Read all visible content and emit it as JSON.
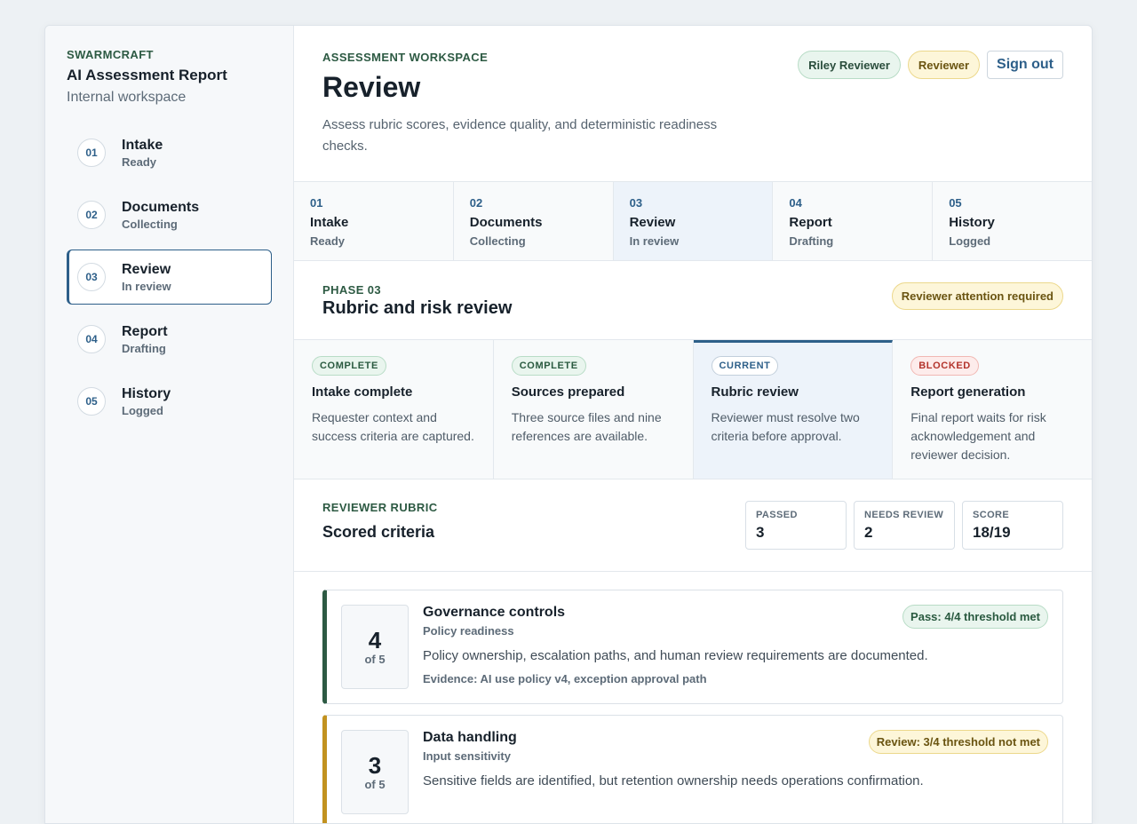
{
  "brand": "SWARMCRAFT",
  "app": {
    "title": "AI Assessment Report",
    "subtitle": "Internal workspace"
  },
  "nav": [
    {
      "num": "01",
      "label": "Intake",
      "status": "Ready"
    },
    {
      "num": "02",
      "label": "Documents",
      "status": "Collecting"
    },
    {
      "num": "03",
      "label": "Review",
      "status": "In review",
      "active": true
    },
    {
      "num": "04",
      "label": "Report",
      "status": "Drafting"
    },
    {
      "num": "05",
      "label": "History",
      "status": "Logged"
    }
  ],
  "header": {
    "eyebrow": "ASSESSMENT WORKSPACE",
    "title": "Review",
    "description": "Assess rubric scores, evidence quality, and deterministic readiness checks.",
    "user": "Riley Reviewer",
    "role": "Reviewer",
    "signout": "Sign out"
  },
  "tabs": [
    {
      "num": "01",
      "label": "Intake",
      "status": "Ready"
    },
    {
      "num": "02",
      "label": "Documents",
      "status": "Collecting"
    },
    {
      "num": "03",
      "label": "Review",
      "status": "In review",
      "active": true
    },
    {
      "num": "04",
      "label": "Report",
      "status": "Drafting"
    },
    {
      "num": "05",
      "label": "History",
      "status": "Logged"
    }
  ],
  "phase": {
    "eyebrow": "PHASE 03",
    "title": "Rubric and risk review",
    "attention": "Reviewer attention required"
  },
  "steps": [
    {
      "badge": "COMPLETE",
      "kind": "complete",
      "title": "Intake complete",
      "desc": "Requester context and success criteria are captured."
    },
    {
      "badge": "COMPLETE",
      "kind": "complete",
      "title": "Sources prepared",
      "desc": "Three source files and nine references are available."
    },
    {
      "badge": "CURRENT",
      "kind": "current",
      "title": "Rubric review",
      "desc": "Reviewer must resolve two criteria before approval."
    },
    {
      "badge": "BLOCKED",
      "kind": "blocked",
      "title": "Report generation",
      "desc": "Final report waits for risk acknowledgement and reviewer decision."
    }
  ],
  "rubric": {
    "eyebrow": "REVIEWER RUBRIC",
    "title": "Scored criteria",
    "stats": [
      {
        "label": "PASSED",
        "value": "3"
      },
      {
        "label": "NEEDS REVIEW",
        "value": "2"
      },
      {
        "label": "SCORE",
        "value": "18/19"
      }
    ]
  },
  "criteria": [
    {
      "score": "4",
      "of": "of 5",
      "title": "Governance controls",
      "category": "Policy readiness",
      "description": "Policy ownership, escalation paths, and human review requirements are documented.",
      "evidence": "Evidence: AI use policy v4, exception approval path",
      "tag": "Pass: 4/4 threshold met",
      "kind": "pass"
    },
    {
      "score": "3",
      "of": "of 5",
      "title": "Data handling",
      "category": "Input sensitivity",
      "description": "Sensitive fields are identified, but retention ownership needs operations confirmation.",
      "evidence": "",
      "tag": "Review: 3/4 threshold not met",
      "kind": "review"
    }
  ]
}
